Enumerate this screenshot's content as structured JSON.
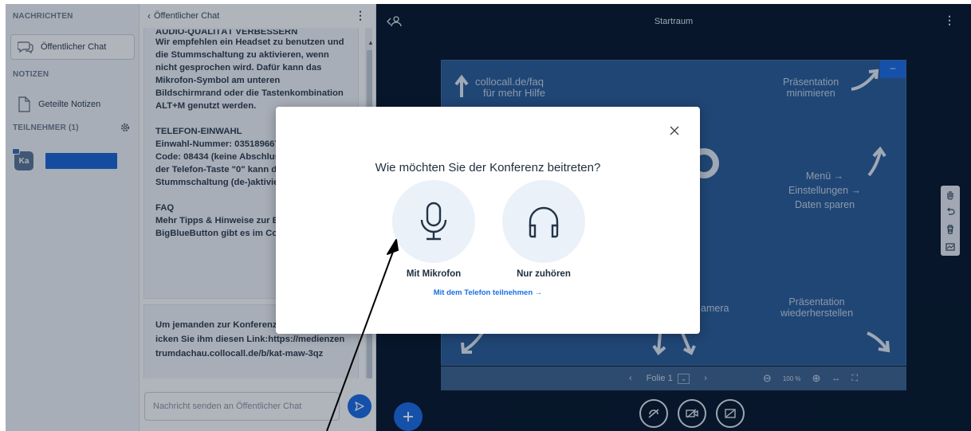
{
  "sidebar": {
    "messages_heading": "NACHRICHTEN",
    "public_chat_label": "Öffentlicher Chat",
    "notes_heading": "NOTIZEN",
    "shared_notes_label": "Geteilte Notizen",
    "participants_heading": "TEILNEHMER (1)",
    "user_initials": "Ka"
  },
  "chat": {
    "header_title": "Öffentlicher Chat",
    "audio_heading": "AUDIO-QUALITÄT VERBESSERN",
    "audio_text": "Wir empfehlen ein Headset zu benutzen und die Stummschaltung zu aktivieren, wenn nicht gesprochen wird. Dafür kann das Mikrofon-Symbol am unteren Bildschirmrand oder die Tastenkombination ALT+M genutzt werden.",
    "phone_heading": "TELEFON-EINWAHL",
    "phone_text": "Einwahl-Nummer: 035189667. Konferenz-Code: 08434 (keine Abschlusszeichen) Mit der Telefon-Taste \"0\" kann die Stummschaltung (de-)aktiviert werden.",
    "faq_heading": "FAQ",
    "faq_text": "Mehr Tipps & Hinweise zur Bedienung von BigBlueButton gibt es im Collocall FAQ.",
    "invite_text": "Um jemanden zur Konferenz einzuladen, schicken Sie ihm diesen Link:https://medienzentrumdachau.collocall.de/b/kat-maw-3qz",
    "input_placeholder": "Nachricht senden an Öffentlicher Chat"
  },
  "main": {
    "room_title": "Startraum",
    "slide_faq_line1": "collocall.de/faq",
    "slide_faq_line2": "für mehr Hilfe",
    "slide_min_line1": "Präsentation",
    "slide_min_line2": "minimieren",
    "slide_menu": "Menü →",
    "slide_settings": "Einstellungen →",
    "slide_data": "Daten sparen",
    "slide_camera": "amera",
    "slide_restore_line1": "Präsentation",
    "slide_restore_line2": "wiederherstellen",
    "slide_label": "Folie 1",
    "zoom": "100 %"
  },
  "modal": {
    "title": "Wie möchten Sie der Konferenz beitreten?",
    "mic_label": "Mit Mikrofon",
    "listen_label": "Nur zuhören",
    "phone_link": "Mit dem Telefon teilnehmen →"
  },
  "colors": {
    "accent": "#1b6ee6",
    "main_bg": "#06172a",
    "slide_bg": "#2b5d99"
  }
}
